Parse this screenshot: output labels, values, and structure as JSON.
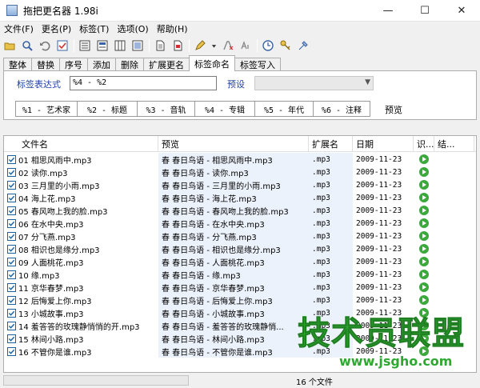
{
  "window": {
    "title": "拖把更名器 1.98i",
    "min": "—",
    "max": "☐",
    "close": "✕"
  },
  "menu": [
    "文件(F)",
    "更名(P)",
    "标签(T)",
    "选项(O)",
    "帮助(H)"
  ],
  "tabs": [
    {
      "label": "整体"
    },
    {
      "label": "替换"
    },
    {
      "label": "序号"
    },
    {
      "label": "添加"
    },
    {
      "label": "删除"
    },
    {
      "label": "扩展更名"
    },
    {
      "label": "标签命名",
      "active": true
    },
    {
      "label": "标签写入"
    }
  ],
  "tag_panel": {
    "expr_label": "标签表达式",
    "expr_value": "%4 - %2",
    "preset_label": "预设",
    "preset_value": "",
    "fields": [
      "%1 - 艺术家",
      "%2 - 标题",
      "%3 - 音轨",
      "%4 - 专辑",
      "%5 - 年代",
      "%6 - 注释"
    ],
    "preview_label": "预览"
  },
  "list": {
    "columns": [
      "文件名",
      "预览",
      "扩展名",
      "日期",
      "识...",
      "结..."
    ],
    "rows": [
      {
        "name": "01 相思风雨中.mp3",
        "preview": "春 春日鸟语 - 相思风雨中.mp3",
        "ext": ".mp3",
        "date": "2009-11-23"
      },
      {
        "name": "02 读你.mp3",
        "preview": "春 春日鸟语 - 读你.mp3",
        "ext": ".mp3",
        "date": "2009-11-23"
      },
      {
        "name": "03 三月里的小雨.mp3",
        "preview": "春 春日鸟语 - 三月里的小雨.mp3",
        "ext": ".mp3",
        "date": "2009-11-23"
      },
      {
        "name": "04 海上花.mp3",
        "preview": "春 春日鸟语 - 海上花.mp3",
        "ext": ".mp3",
        "date": "2009-11-23"
      },
      {
        "name": "05 春风吻上我的脸.mp3",
        "preview": "春 春日鸟语 - 春风吻上我的脸.mp3",
        "ext": ".mp3",
        "date": "2009-11-23"
      },
      {
        "name": "06 在水中央.mp3",
        "preview": "春 春日鸟语 - 在水中央.mp3",
        "ext": ".mp3",
        "date": "2009-11-23"
      },
      {
        "name": "07 分飞燕.mp3",
        "preview": "春 春日鸟语 - 分飞燕.mp3",
        "ext": ".mp3",
        "date": "2009-11-23"
      },
      {
        "name": "08 相识也是缘分.mp3",
        "preview": "春 春日鸟语 - 相识也是缘分.mp3",
        "ext": ".mp3",
        "date": "2009-11-23"
      },
      {
        "name": "09 人面桃花.mp3",
        "preview": "春 春日鸟语 - 人面桃花.mp3",
        "ext": ".mp3",
        "date": "2009-11-23"
      },
      {
        "name": "10 缘.mp3",
        "preview": "春 春日鸟语 - 缘.mp3",
        "ext": ".mp3",
        "date": "2009-11-23"
      },
      {
        "name": "11 京华春梦.mp3",
        "preview": "春 春日鸟语 - 京华春梦.mp3",
        "ext": ".mp3",
        "date": "2009-11-23"
      },
      {
        "name": "12 后悔爱上你.mp3",
        "preview": "春 春日鸟语 - 后悔爱上你.mp3",
        "ext": ".mp3",
        "date": "2009-11-23"
      },
      {
        "name": "13 小城故事.mp3",
        "preview": "春 春日鸟语 - 小城故事.mp3",
        "ext": ".mp3",
        "date": "2009-11-23"
      },
      {
        "name": "14 羞答答的玫瑰静悄悄的开.mp3",
        "preview": "春 春日鸟语 - 羞答答的玫瑰静悄...",
        "ext": ".mp3",
        "date": "2009-11-23"
      },
      {
        "name": "15 林间小路.mp3",
        "preview": "春 春日鸟语 - 林间小路.mp3",
        "ext": ".mp3",
        "date": "2009-11-23"
      },
      {
        "name": "16 不管你是谁.mp3",
        "preview": "春 春日鸟语 - 不管你是谁.mp3",
        "ext": ".mp3",
        "date": "2009-11-23"
      }
    ]
  },
  "status": {
    "count": "16 个文件"
  },
  "watermark": {
    "big": "技术员联盟",
    "url": "www.jsgho.com"
  }
}
